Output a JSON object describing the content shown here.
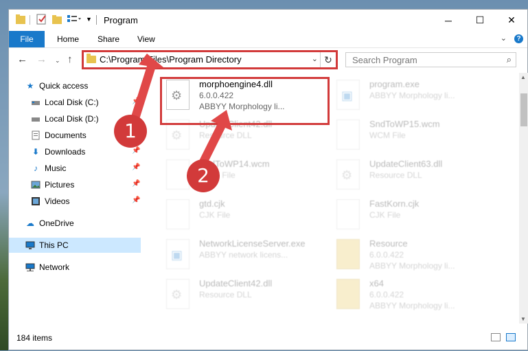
{
  "window": {
    "title": "Program",
    "controls": {
      "minimize": "─",
      "maximize": "☐",
      "close": "✕"
    }
  },
  "ribbon": {
    "tabs": [
      "File",
      "Home",
      "Share",
      "View"
    ],
    "help": "?"
  },
  "address": {
    "path": "C:\\Program Files\\Program Directory"
  },
  "search": {
    "placeholder": "Search Program"
  },
  "sidebar": {
    "items": [
      {
        "label": "Quick access",
        "icon": "star-icon",
        "pinned": false
      },
      {
        "label": "Local Disk (C:)",
        "icon": "drive-icon",
        "pinned": true
      },
      {
        "label": "Local Disk (D:)",
        "icon": "drive-icon",
        "pinned": false
      },
      {
        "label": "Documents",
        "icon": "documents-icon",
        "pinned": true
      },
      {
        "label": "Downloads",
        "icon": "download-icon",
        "pinned": true
      },
      {
        "label": "Music",
        "icon": "music-icon",
        "pinned": true
      },
      {
        "label": "Pictures",
        "icon": "pictures-icon",
        "pinned": true
      },
      {
        "label": "Videos",
        "icon": "videos-icon",
        "pinned": true
      },
      {
        "label": "OneDrive",
        "icon": "cloud-icon",
        "pinned": false
      },
      {
        "label": "This PC",
        "icon": "computer-icon",
        "pinned": false
      },
      {
        "label": "Network",
        "icon": "network-icon",
        "pinned": false
      }
    ]
  },
  "files": [
    {
      "name": "morphoengine4.dll",
      "line1": "6.0.0.422",
      "line2": "ABBYY Morphology li..."
    },
    {
      "name": "program.exe",
      "line1": "ABBYY Morphology li...",
      "line2": ""
    },
    {
      "name": "UpdateClient42.dll",
      "line1": "Resource DLL",
      "line2": ""
    },
    {
      "name": "SndToWP15.wcm",
      "line1": "WCM File",
      "line2": ""
    },
    {
      "name": "SndToWP14.wcm",
      "line1": "WCM File",
      "line2": ""
    },
    {
      "name": "UpdateClient63.dll",
      "line1": "Resource DLL",
      "line2": ""
    },
    {
      "name": "gtd.cjk",
      "line1": "CJK File",
      "line2": ""
    },
    {
      "name": "FastKorn.cjk",
      "line1": "CJK File",
      "line2": ""
    },
    {
      "name": "NetworkLicenseServer.exe",
      "line1": "ABBYY network licens...",
      "line2": ""
    },
    {
      "name": "Resource",
      "line1": "6.0.0.422",
      "line2": "ABBYY Morphology li..."
    },
    {
      "name": "UpdateClient42.dll",
      "line1": "Resource DLL",
      "line2": ""
    },
    {
      "name": "x64",
      "line1": "6.0.0.422",
      "line2": "ABBYY Morphology li..."
    }
  ],
  "status": {
    "count": "184 items"
  },
  "callouts": {
    "one": "1",
    "two": "2"
  },
  "colors": {
    "accent": "#1979ca",
    "callout": "#d23a3a",
    "selected": "#cce8ff"
  }
}
